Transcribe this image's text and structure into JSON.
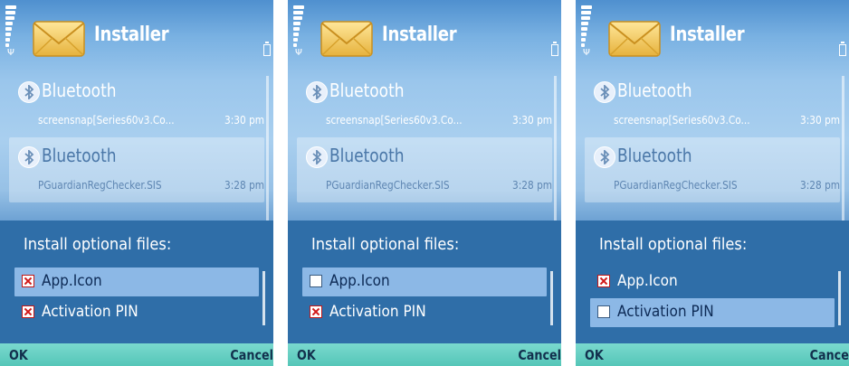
{
  "screens": [
    {
      "title": "Installer",
      "messages": [
        {
          "sender": "Bluetooth",
          "filename": "screensnap[Series60v3.Co...",
          "time": "3:30 pm"
        },
        {
          "sender": "Bluetooth",
          "filename": "PGuardianRegChecker.SIS",
          "time": "3:28 pm"
        }
      ],
      "dialog": {
        "title": "Install optional files:",
        "options": [
          {
            "label": "App.Icon",
            "checked": true,
            "selected": true
          },
          {
            "label": "Activation PIN",
            "checked": true,
            "selected": false
          }
        ]
      },
      "softkeys": {
        "left": "OK",
        "right": "Cancel"
      }
    },
    {
      "title": "Installer",
      "messages": [
        {
          "sender": "Bluetooth",
          "filename": "screensnap[Series60v3.Co...",
          "time": "3:30 pm"
        },
        {
          "sender": "Bluetooth",
          "filename": "PGuardianRegChecker.SIS",
          "time": "3:28 pm"
        }
      ],
      "dialog": {
        "title": "Install optional files:",
        "options": [
          {
            "label": "App.Icon",
            "checked": false,
            "selected": true
          },
          {
            "label": "Activation PIN",
            "checked": true,
            "selected": false
          }
        ]
      },
      "softkeys": {
        "left": "OK",
        "right": "Cancel"
      }
    },
    {
      "title": "Installer",
      "messages": [
        {
          "sender": "Bluetooth",
          "filename": "screensnap[Series60v3.Co...",
          "time": "3:30 pm"
        },
        {
          "sender": "Bluetooth",
          "filename": "PGuardianRegChecker.SIS",
          "time": "3:28 pm"
        }
      ],
      "dialog": {
        "title": "Install optional files:",
        "options": [
          {
            "label": "App.Icon",
            "checked": true,
            "selected": false
          },
          {
            "label": "Activation PIN",
            "checked": false,
            "selected": true
          }
        ]
      },
      "softkeys": {
        "left": "OK",
        "right": "Cance"
      }
    }
  ],
  "icons": {
    "app": "envelope-icon",
    "message": "bluetooth-icon",
    "checked": "checkbox-checked-icon",
    "unchecked": "checkbox-unchecked-icon"
  },
  "colors": {
    "popup": "#2f6ea8",
    "selection": "#8cb8e6",
    "softkeys": "#55c6b8",
    "check_mark": "#d11a1a"
  }
}
